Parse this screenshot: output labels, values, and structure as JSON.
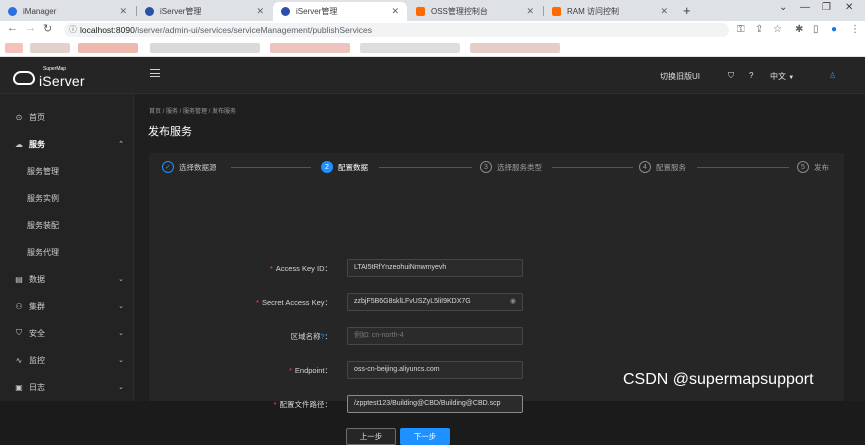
{
  "browser": {
    "tabs": [
      {
        "label": "iManager",
        "color": "#2b6fe0"
      },
      {
        "label": "iServer管理",
        "color": "#2b4fa8"
      },
      {
        "label": "iServer管理",
        "color": "#2b4fa8"
      },
      {
        "label": "OSS管理控制台",
        "color": "#ff6a00"
      },
      {
        "label": "RAM 访问控制",
        "color": "#ff6a00"
      }
    ],
    "new_tab": "+",
    "url_host": "localhost:8090",
    "url_path": "/iserver/admin-ui/services/serviceManagement/publishServices"
  },
  "sidebar": {
    "logo_small": "SuperMap",
    "logo_big": "iServer",
    "items": [
      {
        "label": "首页",
        "icon": "⊙"
      },
      {
        "label": "服务",
        "icon": "☁",
        "arrow": "⌃"
      },
      {
        "label": "服务管理"
      },
      {
        "label": "服务实例"
      },
      {
        "label": "服务装配"
      },
      {
        "label": "服务代理"
      },
      {
        "label": "数据",
        "icon": "▤",
        "arrow": "⌄"
      },
      {
        "label": "集群",
        "icon": "⚇",
        "arrow": "⌄"
      },
      {
        "label": "安全",
        "icon": "⛉",
        "arrow": "⌄"
      },
      {
        "label": "监控",
        "icon": "∿",
        "arrow": "⌄"
      },
      {
        "label": "日志",
        "icon": "▣",
        "arrow": "⌄"
      }
    ]
  },
  "header": {
    "switch_label": "切换旧版UI",
    "lang": "中文",
    "lang_arrow": "▼"
  },
  "breadcrumb": "首页 / 服务 / 服务管理 / 发布服务",
  "page_title": "发布服务",
  "steps": [
    {
      "num": "✓",
      "label": "选择数据源"
    },
    {
      "num": "2",
      "label": "配置数据"
    },
    {
      "num": "3",
      "label": "选择服务类型"
    },
    {
      "num": "4",
      "label": "配置服务"
    },
    {
      "num": "5",
      "label": "发布"
    }
  ],
  "form": {
    "access_key_id": {
      "label": "Access Key ID：",
      "value": "LTAI5tRfYnzeohuiNmwmyevh"
    },
    "secret_access_key": {
      "label": "Secret Access Key：",
      "value": "zzbjF5B6G8sklLFvUSZyL5liI9KDX7G"
    },
    "region": {
      "label": "区域名称",
      "hint": "?",
      "placeholder": "例如: cn-north-4"
    },
    "endpoint": {
      "label": "Endpoint：",
      "value": "oss-cn-beijing.aliyuncs.com"
    },
    "config_path": {
      "label": "配置文件路径：",
      "value": "/zpptest123/Building@CBD/Building@CBD.scp"
    }
  },
  "buttons": {
    "prev": "上一步",
    "next": "下一步"
  },
  "watermark": "CSDN @supermapsupport"
}
